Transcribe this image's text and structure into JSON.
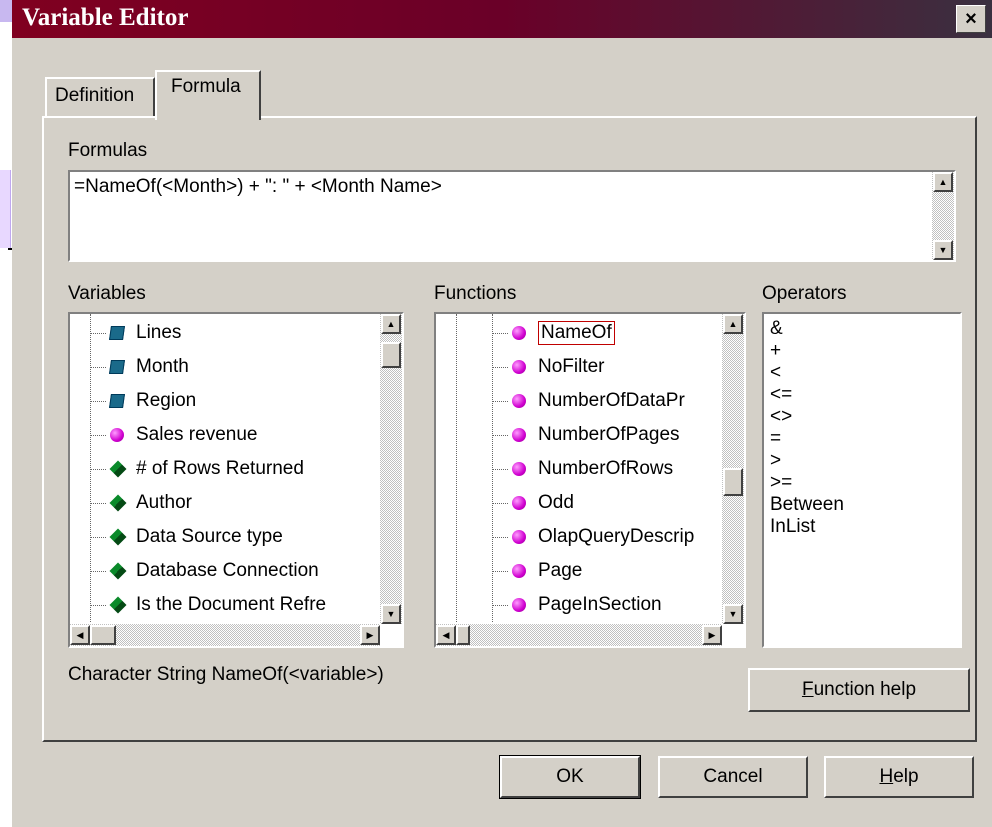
{
  "dialog": {
    "title": "Variable Editor",
    "close_label": "×"
  },
  "tabs": [
    {
      "label": "Definition"
    },
    {
      "label": "Formula"
    }
  ],
  "formulas": {
    "label": "Formulas",
    "value": "=NameOf(<Month>) + \": \" + <Month Name>"
  },
  "variables": {
    "label": "Variables",
    "items": [
      {
        "label": "Lines",
        "icon": "dimension-icon"
      },
      {
        "label": "Month",
        "icon": "dimension-icon"
      },
      {
        "label": "Region",
        "icon": "dimension-icon"
      },
      {
        "label": "Sales revenue",
        "icon": "measure-icon"
      },
      {
        "label": "# of Rows Returned",
        "icon": "info-icon"
      },
      {
        "label": "Author",
        "icon": "info-icon"
      },
      {
        "label": "Data Source type",
        "icon": "info-icon"
      },
      {
        "label": "Database Connection",
        "icon": "info-icon"
      },
      {
        "label": "Is the Document Refre",
        "icon": "info-icon"
      }
    ]
  },
  "functions": {
    "label": "Functions",
    "items": [
      {
        "label": "NameOf",
        "selected": true
      },
      {
        "label": "NoFilter"
      },
      {
        "label": "NumberOfDataPr"
      },
      {
        "label": "NumberOfPages"
      },
      {
        "label": "NumberOfRows"
      },
      {
        "label": "Odd"
      },
      {
        "label": "OlapQueryDescrip"
      },
      {
        "label": "Page"
      },
      {
        "label": "PageInSection"
      }
    ]
  },
  "operators": {
    "label": "Operators",
    "items": [
      "&",
      "+",
      "<",
      "<=",
      "<>",
      "=",
      ">",
      ">=",
      "Between",
      "InList"
    ]
  },
  "syntax": "Character String NameOf(<variable>)",
  "buttons": {
    "function_help_mn": "F",
    "function_help_rest": "unction help",
    "ok": "OK",
    "cancel": "Cancel",
    "help_mn": "H",
    "help_rest": "elp"
  },
  "colors": {
    "title_bar": "#800020",
    "dialog_bg": "#d4d0c8",
    "selection_border": "#c00000"
  }
}
